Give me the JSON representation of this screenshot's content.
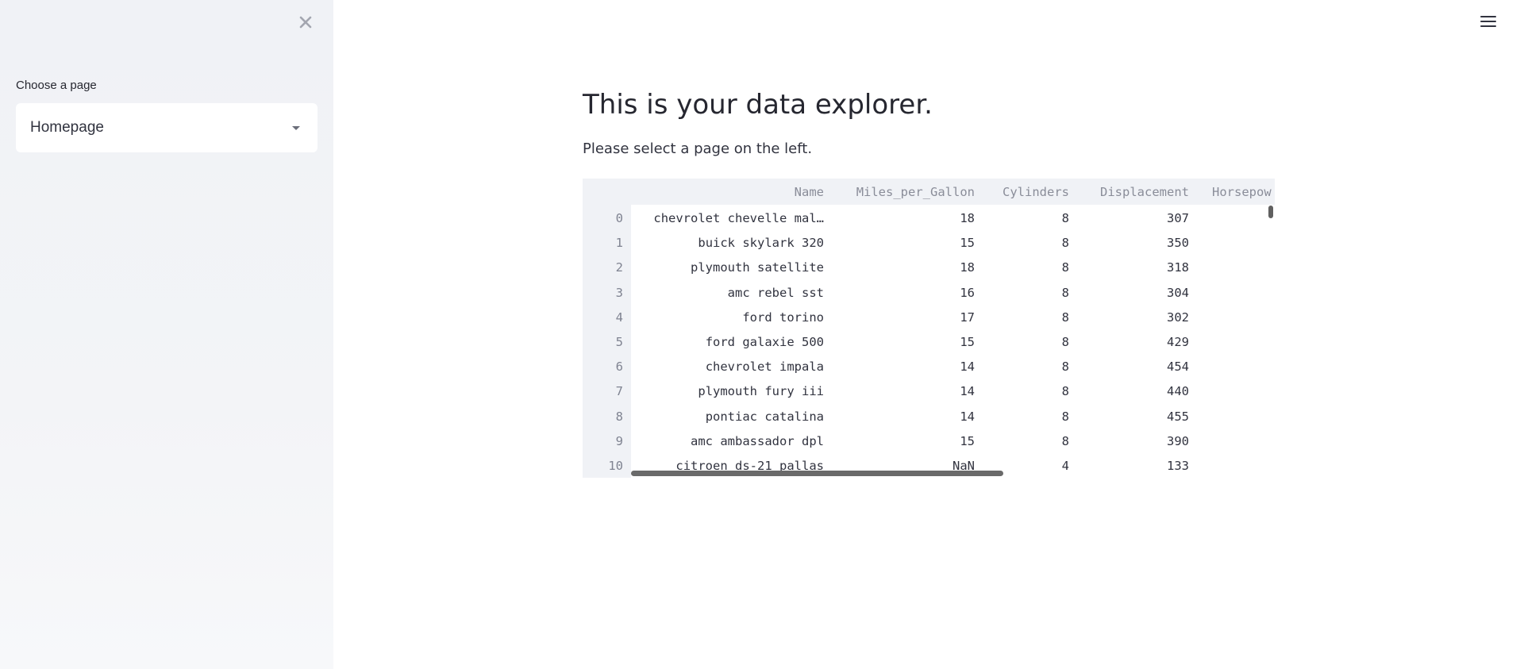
{
  "sidebar": {
    "select_label": "Choose a page",
    "select_value": "Homepage",
    "close_icon": "close-icon"
  },
  "header": {
    "menu_icon": "hamburger-menu-icon"
  },
  "main": {
    "title": "This is your data explorer.",
    "subtitle": "Please select a page on the left."
  },
  "table": {
    "columns": [
      "Name",
      "Miles_per_Gallon",
      "Cylinders",
      "Displacement",
      "Horsepow"
    ],
    "rows": [
      {
        "index": "0",
        "cells": [
          "chevrolet chevelle mal…",
          "18",
          "8",
          "307",
          ""
        ]
      },
      {
        "index": "1",
        "cells": [
          "buick skylark 320",
          "15",
          "8",
          "350",
          ""
        ]
      },
      {
        "index": "2",
        "cells": [
          "plymouth satellite",
          "18",
          "8",
          "318",
          ""
        ]
      },
      {
        "index": "3",
        "cells": [
          "amc rebel sst",
          "16",
          "8",
          "304",
          ""
        ]
      },
      {
        "index": "4",
        "cells": [
          "ford torino",
          "17",
          "8",
          "302",
          ""
        ]
      },
      {
        "index": "5",
        "cells": [
          "ford galaxie 500",
          "15",
          "8",
          "429",
          ""
        ]
      },
      {
        "index": "6",
        "cells": [
          "chevrolet impala",
          "14",
          "8",
          "454",
          ""
        ]
      },
      {
        "index": "7",
        "cells": [
          "plymouth fury iii",
          "14",
          "8",
          "440",
          ""
        ]
      },
      {
        "index": "8",
        "cells": [
          "pontiac catalina",
          "14",
          "8",
          "455",
          ""
        ]
      },
      {
        "index": "9",
        "cells": [
          "amc ambassador dpl",
          "15",
          "8",
          "390",
          ""
        ]
      },
      {
        "index": "10",
        "cells": [
          "citroen ds-21 pallas",
          "NaN",
          "4",
          "133",
          ""
        ]
      }
    ]
  }
}
